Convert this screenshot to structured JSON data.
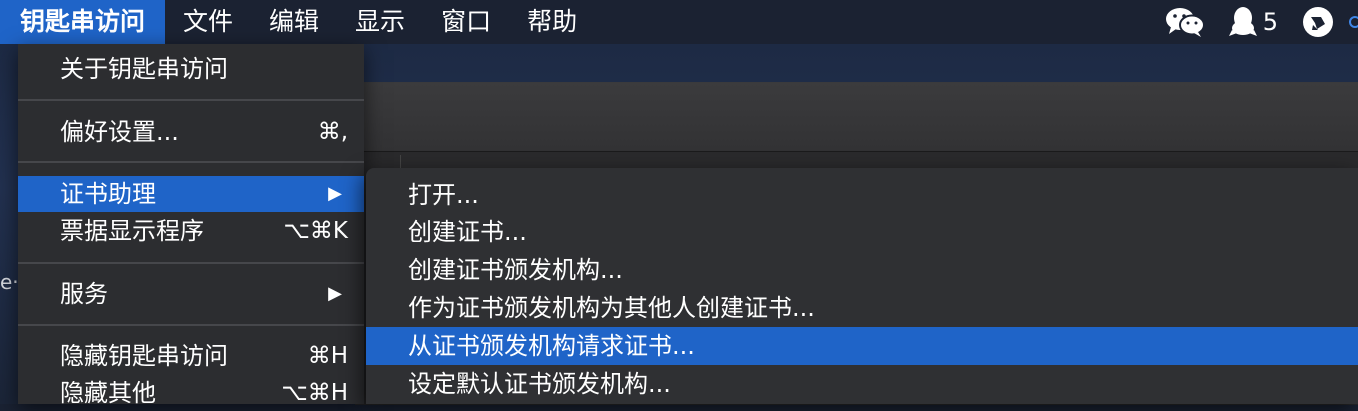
{
  "menubar": {
    "app_name": "钥匙串访问",
    "items": [
      "文件",
      "编辑",
      "显示",
      "窗口",
      "帮助"
    ],
    "status": {
      "qq_count": "5"
    }
  },
  "background": {
    "edge_text": "e·"
  },
  "app_menu": {
    "items": [
      {
        "label": "关于钥匙串访问",
        "shortcut": ""
      },
      {
        "label": "偏好设置...",
        "shortcut": "⌘,"
      },
      {
        "label": "证书助理",
        "shortcut": "",
        "submenu": true,
        "highlighted": true
      },
      {
        "label": "票据显示程序",
        "shortcut": "⌥⌘K"
      },
      {
        "label": "服务",
        "shortcut": "",
        "submenu": true
      },
      {
        "label": "隐藏钥匙串访问",
        "shortcut": "⌘H"
      },
      {
        "label": "隐藏其他",
        "shortcut": "⌥⌘H"
      }
    ],
    "submenu_arrow": "▶"
  },
  "certificate_assistant_submenu": {
    "items": [
      {
        "label": "打开..."
      },
      {
        "label": "创建证书..."
      },
      {
        "label": "创建证书颁发机构..."
      },
      {
        "label": "作为证书颁发机构为其他人创建证书..."
      },
      {
        "label": "从证书颁发机构请求证书...",
        "highlighted": true
      },
      {
        "label": "设定默认证书颁发机构..."
      }
    ]
  },
  "colors": {
    "highlight": "#1f64c8",
    "menubar_bg": "#1b2232",
    "menu_bg": "#2c2d30"
  },
  "icons": [
    "wechat-icon",
    "qq-icon",
    "feishu-icon"
  ]
}
